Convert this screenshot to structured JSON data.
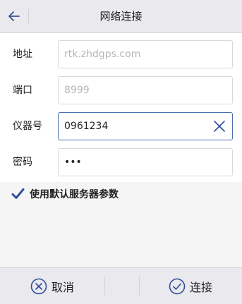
{
  "header": {
    "title": "网络连接",
    "back_icon": "arrow-left-icon"
  },
  "form": {
    "fields": [
      {
        "label": "地址",
        "value": "",
        "placeholder": "rtk.zhdgps.com"
      },
      {
        "label": "端口",
        "value": "",
        "placeholder": "8999"
      },
      {
        "label": "仪器号",
        "value": "0961234",
        "placeholder": ""
      },
      {
        "label": "密码",
        "value": "•••",
        "placeholder": ""
      }
    ]
  },
  "settings": {
    "use_default_server": {
      "label": "使用默认服务器参数",
      "checked": true
    }
  },
  "footer": {
    "cancel_label": "取消",
    "connect_label": "连接"
  },
  "colors": {
    "accent": "#2f4e9c",
    "header_bg": "#e9e9ee"
  }
}
